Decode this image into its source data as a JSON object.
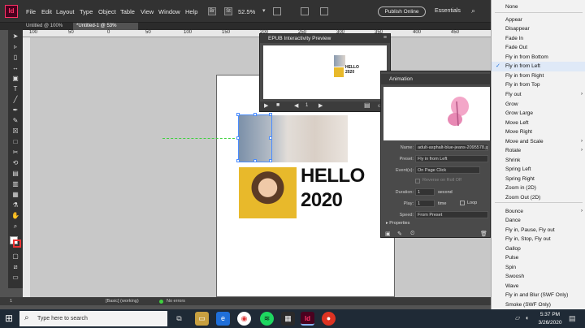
{
  "app": {
    "logo": "Id"
  },
  "menus": [
    "File",
    "Edit",
    "Layout",
    "Type",
    "Object",
    "Table",
    "View",
    "Window",
    "Help"
  ],
  "toolbar": {
    "box1": "Br",
    "box2": "St",
    "zoom": "52.5%",
    "publish_label": "Publish Online",
    "workspace": "Essentials"
  },
  "tabs": [
    {
      "label": "Untitled @ 100%"
    },
    {
      "label": "*Untitled-1 @ 53%"
    }
  ],
  "ruler": {
    "ticks": [
      "100",
      "50",
      "0",
      "50",
      "100",
      "150",
      "200",
      "250",
      "300",
      "350",
      "400",
      "450"
    ]
  },
  "document": {
    "headline_line1": "HELLO",
    "headline_line2": "2020"
  },
  "epub_panel": {
    "title": "EPUB Interactivity Preview",
    "page_number": "1",
    "thumb_headline1": "HELLO",
    "thumb_headline2": "2020"
  },
  "animation_panel": {
    "title": "Animation",
    "name_label": "Name:",
    "name_value": "adult-asphalt-blue-jeans-2095578.jpg",
    "preset_label": "Preset:",
    "preset_value": "Fly in from Left",
    "events_label": "Event(s):",
    "events_value": "On Page Click",
    "reverse_label": "Reverse on Roll Off",
    "duration_label": "Duration:",
    "duration_value": "1",
    "duration_unit": "second",
    "play_label": "Play:",
    "play_value": "1",
    "play_unit": "time",
    "loop_label": "Loop",
    "speed_label": "Speed:",
    "speed_value": "From Preset",
    "properties_label": "Properties"
  },
  "preset_menu": {
    "items": [
      {
        "label": "None"
      },
      {
        "label": "Appear"
      },
      {
        "label": "Disappear"
      },
      {
        "label": "Fade In"
      },
      {
        "label": "Fade Out"
      },
      {
        "label": "Fly in from Bottom"
      },
      {
        "label": "Fly in from Left",
        "checked": true
      },
      {
        "label": "Fly in from Right"
      },
      {
        "label": "Fly in from Top"
      },
      {
        "label": "Fly out",
        "submenu": true
      },
      {
        "label": "Grow"
      },
      {
        "label": "Grow Large"
      },
      {
        "label": "Move Left"
      },
      {
        "label": "Move Right"
      },
      {
        "label": "Move and Scale",
        "submenu": true
      },
      {
        "label": "Rotate",
        "submenu": true
      },
      {
        "label": "Shrink"
      },
      {
        "label": "Spring Left"
      },
      {
        "label": "Spring Right"
      },
      {
        "label": "Zoom in (2D)"
      },
      {
        "label": "Zoom Out (2D)"
      },
      {
        "label": "Bounce",
        "submenu": true
      },
      {
        "label": "Dance"
      },
      {
        "label": "Fly in, Pause, Fly out"
      },
      {
        "label": "Fly in, Stop, Fly out"
      },
      {
        "label": "Gallop"
      },
      {
        "label": "Pulse"
      },
      {
        "label": "Spin"
      },
      {
        "label": "Swoosh"
      },
      {
        "label": "Wave"
      },
      {
        "label": "Fly in and Blur (SWF Only)"
      },
      {
        "label": "Smoke (SWF Only)"
      }
    ]
  },
  "status": {
    "page": "1",
    "preflight_profile": "[Basic] (working)",
    "errors": "No errors"
  },
  "taskbar": {
    "search_placeholder": "Type here to search",
    "time": "5:37 PM",
    "date": "3/26/2020"
  },
  "colors": {
    "accent": "#1e6fd9",
    "app_brand": "#ff3366",
    "panel_bg": "#4a4a4a",
    "menu_bg": "#f2f2f2"
  }
}
